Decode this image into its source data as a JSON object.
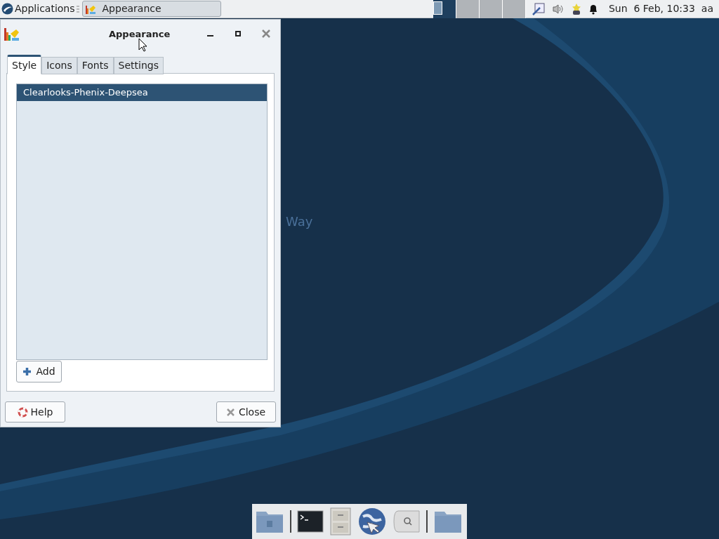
{
  "panel": {
    "menu_label": "Applications",
    "tasks": [
      {
        "label": "Appearance",
        "selected": true
      }
    ],
    "workspaces": [
      {
        "selected": true
      },
      {
        "selected": false
      },
      {
        "selected": false
      },
      {
        "selected": false
      }
    ],
    "clock": "Sun  6 Feb, 10:33",
    "user": "aa"
  },
  "window": {
    "title": "Appearance",
    "tabs": [
      {
        "label": "Style",
        "selected": true
      },
      {
        "label": "Icons",
        "selected": false
      },
      {
        "label": "Fonts",
        "selected": false
      },
      {
        "label": "Settings",
        "selected": false
      }
    ],
    "themes": [
      {
        "label": "Clearlooks-Phenix-Deepsea",
        "selected": true
      }
    ],
    "add_button": "Add",
    "help_button": "Help",
    "close_button": "Close"
  },
  "desktop": {
    "wallpaper_text": "Way"
  }
}
